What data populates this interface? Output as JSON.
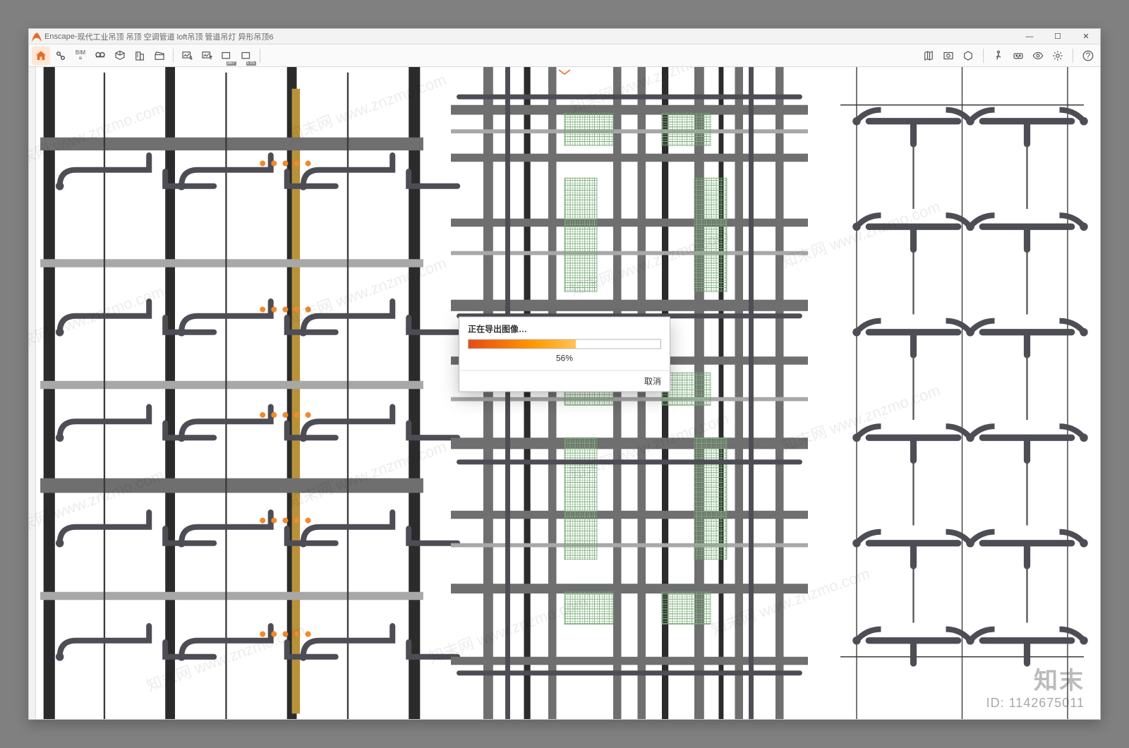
{
  "app": {
    "name": "Enscape",
    "title_sep": " - ",
    "document_title": "现代工业吊顶 吊顶 空调管道 loft吊顶 管道吊灯 异形吊顶6"
  },
  "window_controls": {
    "min": "—",
    "max": "☐",
    "close": "✕"
  },
  "toolbar": {
    "left": {
      "home": "home-icon",
      "link": "link-icon",
      "bim": "BIM",
      "search": "binoculars-icon",
      "axo": "cube-axo-icon",
      "building": "building-icon",
      "clapper": "clapper-icon"
    },
    "mid": {
      "img_in": "image-import-icon",
      "img_out": "image-export-icon",
      "pano": "360°",
      "exe": "EXE"
    },
    "right": {
      "map": "map-icon",
      "photo": "photo-icon",
      "box": "box-icon",
      "walk": "walk-icon",
      "vr": "vr-icon",
      "eye": "eye-icon",
      "gear": "gear-icon",
      "help": "?"
    }
  },
  "dialog": {
    "title": "正在导出图像…",
    "percent": 56,
    "percent_label": "56%",
    "cancel": "取消"
  },
  "watermark": {
    "brand": "知末",
    "id_label": "ID: 1142675011",
    "diag": "知末网 www.znzmo.com"
  },
  "colors": {
    "accent": "#e96b24",
    "beam_dark": "#2b2b2b",
    "beam_mid": "#6f6f6f",
    "beam_light": "#a8a8a8",
    "pipe": "#4d4d55",
    "grid_green": "#7fb07f",
    "bulb": "#f08a2c"
  }
}
